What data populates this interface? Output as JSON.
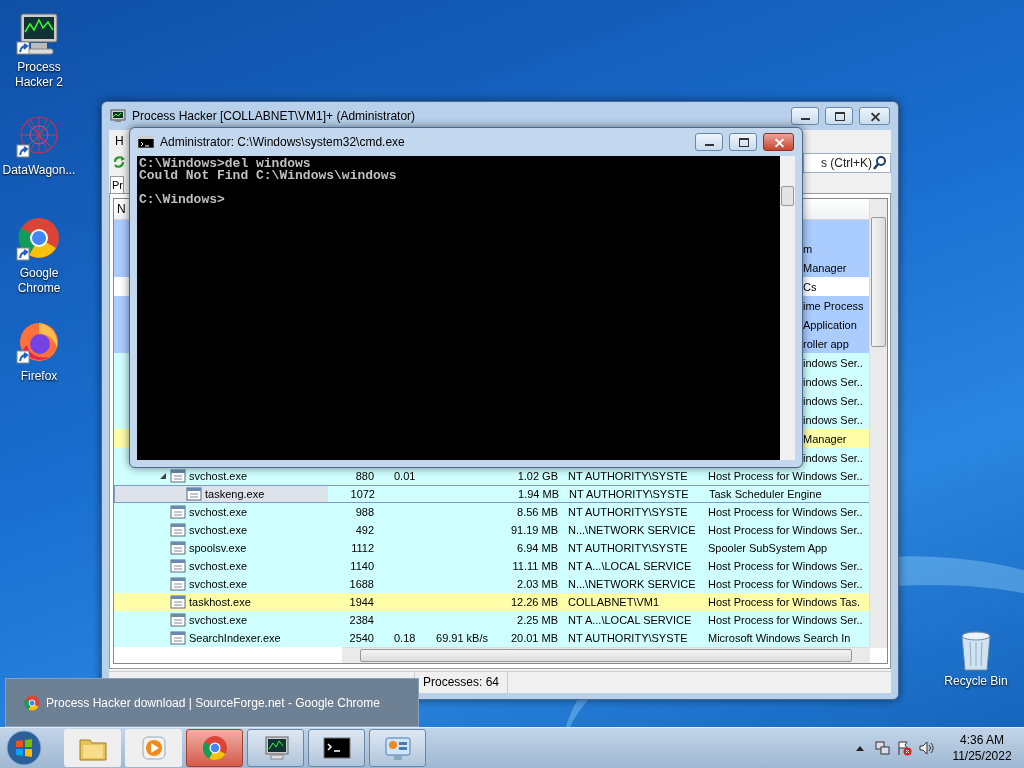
{
  "desktop_icons": [
    {
      "label": "Process Hacker 2",
      "kind": "monitor"
    },
    {
      "label": "DataWagon...",
      "kind": "mesh"
    },
    {
      "label": "Google Chrome",
      "kind": "chrome"
    },
    {
      "label": "Firefox",
      "kind": "firefox"
    }
  ],
  "recycle_bin": {
    "label": "Recycle Bin"
  },
  "process_hacker": {
    "title": "Process Hacker [COLLABNET\\VM1]+ (Administrator)",
    "menu": [
      "H"
    ],
    "search": {
      "placeholder": "s (Ctrl+K)"
    },
    "tabs": [
      {
        "label": "Pr",
        "selected": true
      }
    ],
    "columns": [
      "N"
    ],
    "rows": [
      {
        "color": "#aaccff",
        "selected": false
      },
      {
        "column_7": "m",
        "color": "#aaccff",
        "selected": false
      },
      {
        "column_7": "Manager",
        "color": "#aaccff",
        "selected": false
      },
      {
        "column_7": "Cs",
        "color": "#ffffff",
        "selected": false
      },
      {
        "column_7": "ime Process",
        "color": "#aaccff",
        "selected": false
      },
      {
        "column_7": "Application",
        "color": "#aaccff",
        "selected": false
      },
      {
        "column_7": "roller app",
        "color": "#aaccff",
        "selected": false
      },
      {
        "column_7": "indows Ser..",
        "color": "#d0ffff",
        "selected": false
      },
      {
        "column_7": "indows Ser..",
        "color": "#d0ffff",
        "selected": false
      },
      {
        "column_7": "indows Ser..",
        "color": "#d0ffff",
        "selected": false
      },
      {
        "column_7": "indows Ser..",
        "color": "#d0ffff",
        "selected": false
      },
      {
        "column_7": "Manager",
        "color": "#ffffaa",
        "selected": false
      },
      {
        "column_7": "indows Ser..",
        "color": "#d0ffff",
        "selected": false
      },
      {
        "column_1": "svchost.exe",
        "column_2": "880",
        "column_3": "0.01",
        "column_5": "1.02 GB",
        "column_6": "NT AUTHORITY\\SYSTE",
        "column_7": "Host Process for Windows Ser..",
        "color": "#d0ffff",
        "selected": false,
        "expanded": true,
        "children": [
          {
            "column_1": "taskeng.exe",
            "column_2": "1072",
            "column_5": "1.94 MB",
            "column_6": "NT AUTHORITY\\SYSTE",
            "column_7": "Task Scheduler Engine",
            "color": "#d0ffff",
            "selected": true
          }
        ]
      },
      {
        "column_1": "svchost.exe",
        "column_2": "988",
        "column_5": "8.56 MB",
        "column_6": "NT AUTHORITY\\SYSTE",
        "column_7": "Host Process for Windows Ser..",
        "color": "#d0ffff",
        "selected": false
      },
      {
        "column_1": "svchost.exe",
        "column_2": "492",
        "column_5": "91.19 MB",
        "column_6": "N...\\NETWORK SERVICE",
        "column_7": "Host Process for Windows Ser..",
        "color": "#d0ffff",
        "selected": false
      },
      {
        "column_1": "spoolsv.exe",
        "column_2": "1112",
        "column_5": "6.94 MB",
        "column_6": "NT AUTHORITY\\SYSTE",
        "column_7": "Spooler SubSystem App",
        "color": "#d0ffff",
        "selected": false
      },
      {
        "column_1": "svchost.exe",
        "column_2": "1140",
        "column_5": "11.11 MB",
        "column_6": "NT A...\\LOCAL SERVICE",
        "column_7": "Host Process for Windows Ser..",
        "color": "#d0ffff",
        "selected": false
      },
      {
        "column_1": "svchost.exe",
        "column_2": "1688",
        "column_5": "2.03 MB",
        "column_6": "N...\\NETWORK SERVICE",
        "column_7": "Host Process for Windows Ser..",
        "color": "#d0ffff",
        "selected": false
      },
      {
        "column_1": "taskhost.exe",
        "column_2": "1944",
        "column_5": "12.26 MB",
        "column_6": "COLLABNET\\VM1",
        "column_7": "Host Process for Windows Tas.",
        "color": "#ffffaa",
        "selected": false
      },
      {
        "column_1": "svchost.exe",
        "column_2": "2384",
        "column_5": "2.25 MB",
        "column_6": "NT A...\\LOCAL SERVICE",
        "column_7": "Host Process for Windows Ser..",
        "color": "#d0ffff",
        "selected": false
      },
      {
        "column_1": "SearchIndexer.exe",
        "column_2": "2540",
        "column_3": "0.18",
        "column_4": "69.91 kB/s",
        "column_5": "20.01 MB",
        "column_6": "NT AUTHORITY\\SYSTE",
        "column_7": "Microsoft Windows Search In",
        "color": "#d0ffff",
        "selected": false
      }
    ],
    "status_bar": [
      "Processes: 64"
    ]
  },
  "cmd": {
    "title": "Administrator: C:\\Windows\\system32\\cmd.exe",
    "output": [
      "C:\\Windows>del windows",
      "Could Not Find C:\\Windows\\windows"
    ],
    "prompt": "C:\\Windows>"
  },
  "chrome_preview": {
    "title": "Process Hacker download | SourceForge.net - Google Chrome"
  },
  "taskbar": {
    "buttons": [
      {
        "kind": "explorer",
        "running": false,
        "hovered": false
      },
      {
        "kind": "media",
        "running": false,
        "hovered": false
      },
      {
        "kind": "chrome",
        "running": true,
        "hovered": true
      },
      {
        "kind": "monitor",
        "running": true,
        "hovered": false
      },
      {
        "kind": "cmd",
        "running": true,
        "hovered": false
      },
      {
        "kind": "panel",
        "running": true,
        "hovered": false
      }
    ],
    "tray": [
      {
        "kind": "arrow"
      },
      {
        "kind": "network"
      },
      {
        "kind": "flag"
      },
      {
        "kind": "speaker"
      }
    ],
    "clock": {
      "time": "4:36 AM",
      "date": "11/25/2022"
    }
  }
}
